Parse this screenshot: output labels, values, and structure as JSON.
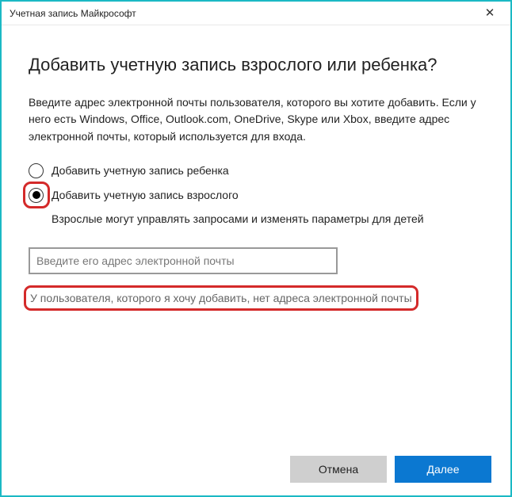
{
  "titlebar": {
    "title": "Учетная запись Майкрософт"
  },
  "main": {
    "heading": "Добавить учетную запись взрослого или ребенка?",
    "description": "Введите адрес электронной почты пользователя, которого вы хотите добавить. Если у него есть Windows, Office, Outlook.com, OneDrive, Skype или Xbox, введите адрес электронной почты, который используется для входа.",
    "options": {
      "child": "Добавить учетную запись ребенка",
      "adult": "Добавить учетную запись взрослого"
    },
    "selected": "adult",
    "hint": "Взрослые могут управлять запросами и изменять параметры для детей",
    "email_placeholder": "Введите его адрес электронной почты",
    "no_email_link": "У пользователя, которого я хочу добавить, нет адреса электронной почты"
  },
  "footer": {
    "cancel": "Отмена",
    "next": "Далее"
  }
}
